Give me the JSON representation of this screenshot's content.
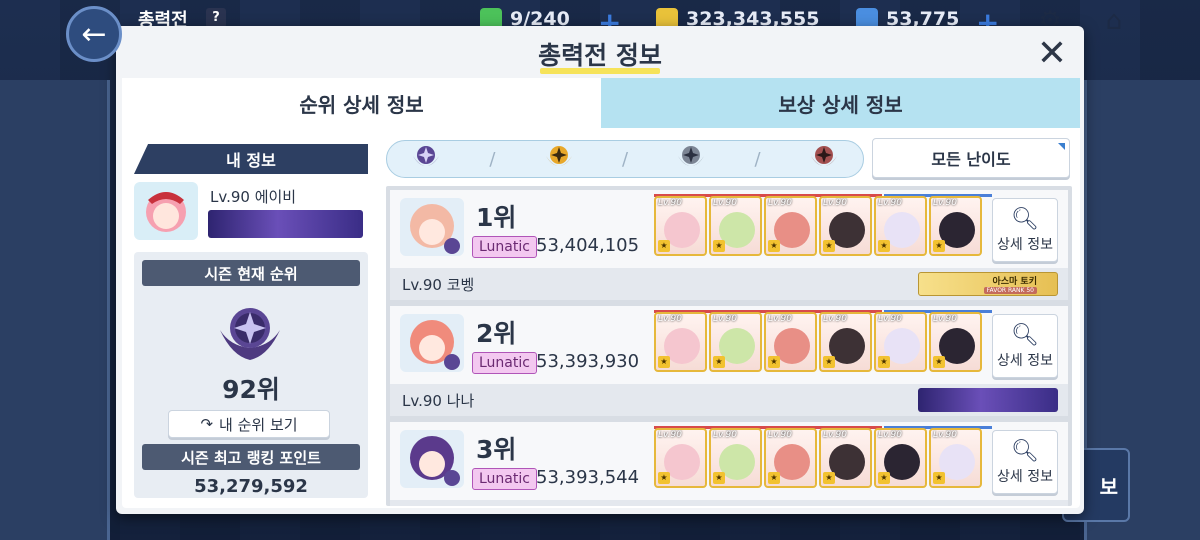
{
  "hud": {
    "title": "총력전",
    "help_label": "?",
    "ap": "9/240",
    "credits": "323,343,555",
    "pyroxene": "53,775",
    "plus_label": "+"
  },
  "dialog": {
    "title": "총력전 정보",
    "close_label": "✕",
    "tabs": [
      "순위 상세 정보",
      "보상 상세 정보"
    ],
    "active_tab": 0
  },
  "my_info": {
    "header": "내 정보",
    "name": "Lv.90 에이비",
    "season_rank_header": "시즌 현재 순위",
    "rank": "92위",
    "my_rank_button": "내 순위 보기",
    "best_points_header": "시즌 최고 랭킹 포인트",
    "best_points": "53,279,592"
  },
  "difficulty": {
    "emblems": [
      "purple-emblem",
      "gold-emblem",
      "gray-emblem",
      "red-emblem"
    ],
    "selected": "모든 난이도"
  },
  "ranking": [
    {
      "rank": "1위",
      "difficulty": "Lunatic",
      "score": "53,404,105",
      "name": "Lv.90 코벵",
      "avatar_color": "#f3b9a5",
      "banner": "favor",
      "banner_name": "아스마 토키",
      "banner_rank": "FAVOR RANK 50",
      "detail_label": "상세 정보",
      "team": [
        {
          "lv": "Lv.90",
          "face": "#f5c6cf"
        },
        {
          "lv": "Lv.90",
          "face": "#cde6a8"
        },
        {
          "lv": "Lv.90",
          "face": "#e88f86"
        },
        {
          "lv": "Lv.90",
          "face": "#3d3135"
        },
        {
          "lv": "Lv.90",
          "face": "#e8e2f6"
        },
        {
          "lv": "Lv.90",
          "face": "#2b2532"
        }
      ]
    },
    {
      "rank": "2위",
      "difficulty": "Lunatic",
      "score": "53,393,930",
      "name": "Lv.90 나나",
      "avatar_color": "#f08b7c",
      "banner": "purple",
      "detail_label": "상세 정보",
      "team": [
        {
          "lv": "Lv.90",
          "face": "#f5c6cf"
        },
        {
          "lv": "Lv.90",
          "face": "#cde6a8"
        },
        {
          "lv": "Lv.90",
          "face": "#e88f86"
        },
        {
          "lv": "Lv.90",
          "face": "#3d3135"
        },
        {
          "lv": "Lv.90",
          "face": "#e8e2f6"
        },
        {
          "lv": "Lv.90",
          "face": "#2b2532"
        }
      ]
    },
    {
      "rank": "3위",
      "difficulty": "Lunatic",
      "score": "53,393,544",
      "name": "",
      "avatar_color": "#5b3a8c",
      "banner": "none",
      "detail_label": "상세 정보",
      "team": [
        {
          "lv": "Lv.90",
          "face": "#f5c6cf"
        },
        {
          "lv": "Lv.90",
          "face": "#cde6a8"
        },
        {
          "lv": "Lv.90",
          "face": "#e88f86"
        },
        {
          "lv": "Lv.90",
          "face": "#3d3135"
        },
        {
          "lv": "Lv.90",
          "face": "#2b2532"
        },
        {
          "lv": "Lv.90",
          "face": "#e8e2f6"
        }
      ]
    }
  ],
  "background": {
    "right_button_label": "보"
  },
  "colors": {
    "accent_yellow": "#f6e35a",
    "tab_inactive": "#b5e2f1",
    "header_navy": "#2d3f62",
    "lunatic_bg": "#f3c8f0"
  }
}
